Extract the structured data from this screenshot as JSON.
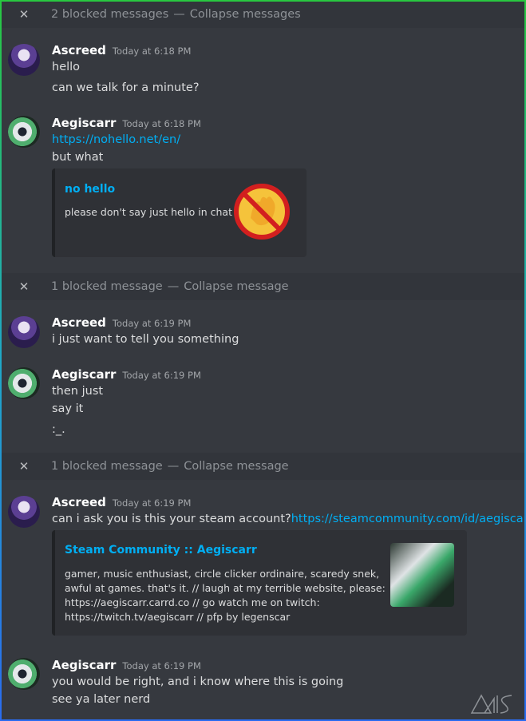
{
  "blocked": [
    {
      "icon": "close-icon",
      "text": "2 blocked messages",
      "sep": "—",
      "action": "Collapse messages"
    },
    {
      "icon": "close-icon",
      "text": "1 blocked message",
      "sep": "—",
      "action": "Collapse message"
    },
    {
      "icon": "close-icon",
      "text": "1 blocked message",
      "sep": "—",
      "action": "Collapse message"
    }
  ],
  "messages": [
    {
      "author": "Ascreed",
      "time": "Today at 6:18 PM",
      "lines": [
        "hello",
        "can we talk for a minute?"
      ]
    },
    {
      "author": "Aegiscarr",
      "time": "Today at 6:18 PM",
      "link": "https://nohello.net/en/",
      "lines": [
        "but what"
      ],
      "embed": {
        "title": "no hello",
        "description": "please don't say just hello in chat"
      }
    },
    {
      "author": "Ascreed",
      "time": "Today at 6:19 PM",
      "lines": [
        "i just want to tell you something"
      ]
    },
    {
      "author": "Aegiscarr",
      "time": "Today at 6:19 PM",
      "lines": [
        "then just",
        "say it",
        ":_."
      ]
    },
    {
      "author": "Ascreed",
      "time": "Today at 6:19 PM",
      "text_prefix": "can i ask you is this your steam account?",
      "link": "https://steamcommunity.com/id/aegiscarr/",
      "embed": {
        "title": "Steam Community :: Aegiscarr",
        "description_lines": [
          "gamer, music enthusiast, circle clicker ordinaire, scaredy snek,",
          "awful at games. that's it. // laugh at my terrible website, please:",
          "https://aegiscarr.carrd.co // go watch me on twitch:",
          "https://twitch.tv/aegiscarr // pfp by legenscar"
        ]
      }
    },
    {
      "author": "Aegiscarr",
      "time": "Today at 6:19 PM",
      "lines": [
        "you would be right, and i know where this is going",
        "see ya later nerd"
      ]
    }
  ],
  "colors": {
    "background": "#36393f",
    "blocked_bar": "#32353b",
    "embed_bg": "#2f3136",
    "link": "#00aff4"
  }
}
